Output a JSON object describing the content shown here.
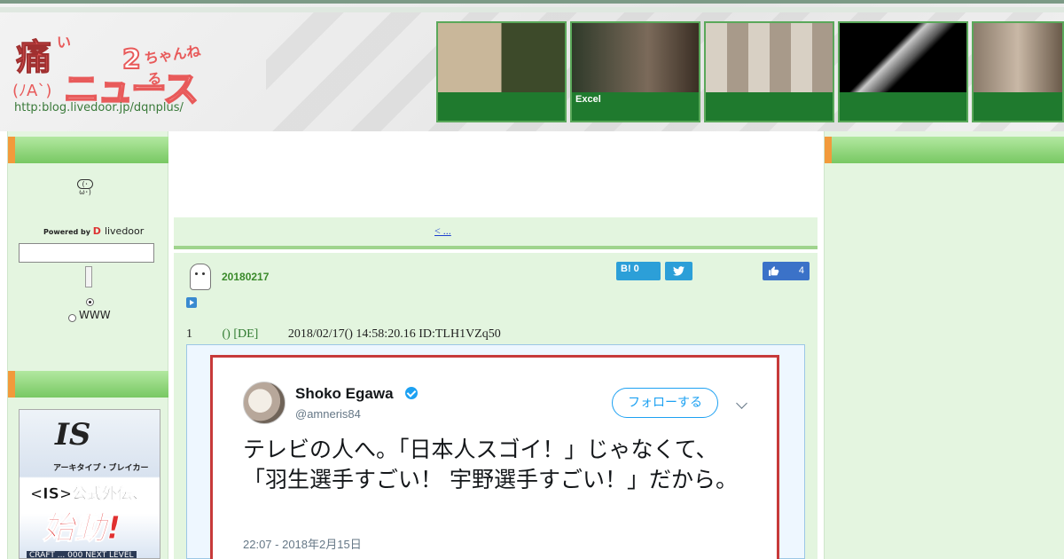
{
  "header": {
    "logo": {
      "kanji": "痛",
      "small_i": "い",
      "chan": "ちゃんねる",
      "big2": "2",
      "news": "ニュース",
      "face": "(ﾉA`)",
      "url": "http:blog.livedoor.jp/dqnplus/"
    },
    "thumbnails": [
      {
        "caption": "",
        "colors": [
          "#6b7a4a",
          "#d9c3a8"
        ]
      },
      {
        "caption": "Excel",
        "colors": [
          "#2f3a2a",
          "#7b6a5a"
        ]
      },
      {
        "caption": "",
        "colors": [
          "#a8a8a8",
          "#e0d0c0"
        ]
      },
      {
        "caption": "",
        "colors": [
          "#111111",
          "#3a3a3a"
        ]
      },
      {
        "caption": "",
        "colors": [
          "#8a7a6a",
          "#c9b8a6"
        ]
      }
    ]
  },
  "left_sidebar": {
    "emoji_label": "(･ω･)",
    "powered_by": "Powered by",
    "livedoor_mark": "D",
    "livedoor": "livedoor",
    "search_value": "",
    "radio_www": "WWW"
  },
  "ad": {
    "logo": "IS",
    "subtitle": "アーキタイプ・ブレイカー",
    "line1": "<IS>公式外伝、",
    "line2": "始動!",
    "bottom": "CRAFT ... 000 NEXT LEVEL"
  },
  "main": {
    "nav_link": "< ...",
    "post_date": "20180217",
    "hatena_label": "B!",
    "hatena_count": "0",
    "like_count": "4",
    "res": {
      "number": "1",
      "name": "() [DE]",
      "meta": "2018/02/17() 14:58:20.16 ID:TLH1VZq50"
    },
    "tweet": {
      "name": "Shoko Egawa",
      "handle": "@amneris84",
      "follow": "フォローする",
      "text": "テレビの人へ。「日本人スゴイ！」じゃなくて、「羽生選手すごい！ 宇野選手すごい！」だから。",
      "time": "22:07 - 2018年2月15日"
    }
  },
  "colors": {
    "accent_green": "#78c863",
    "accent_orange": "#f29a3b",
    "link_blue": "#1b3fcf",
    "twitter_blue": "#1da1f2"
  }
}
